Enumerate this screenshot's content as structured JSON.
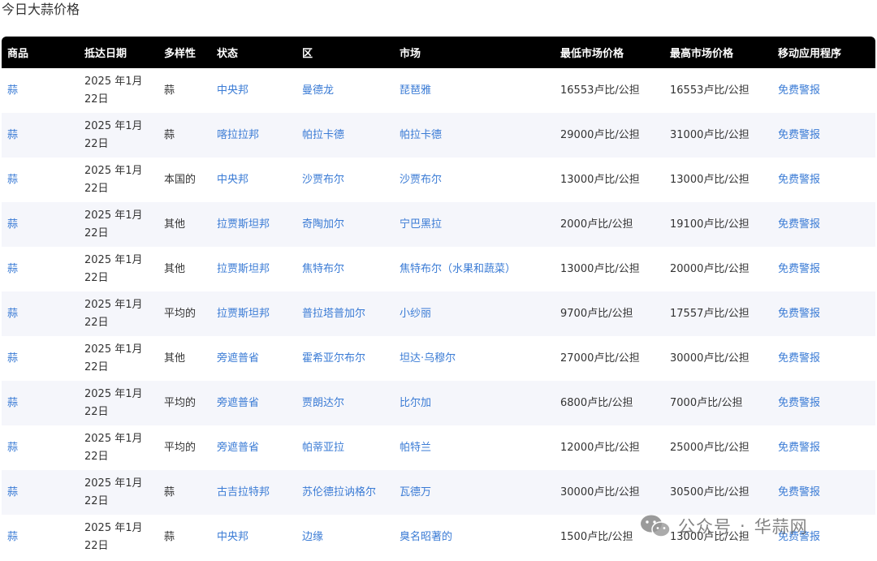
{
  "page": {
    "title": "今日大蒜价格"
  },
  "table": {
    "columns": [
      "商品",
      "抵达日期",
      "多样性",
      "状态",
      "区",
      "市场",
      "最低市场价格",
      "最高市场价格",
      "移动应用程序"
    ],
    "rows": [
      {
        "commodity": "蒜",
        "date": "2025 年1月22日",
        "variety": "蒜",
        "state": "中央邦",
        "district": "曼德龙",
        "market": "琵琶雅",
        "min_price": "16553卢比/公担",
        "max_price": "16553卢比/公担",
        "app": "免费警报"
      },
      {
        "commodity": "蒜",
        "date": "2025 年1月22日",
        "variety": "蒜",
        "state": "喀拉拉邦",
        "district": "帕拉卡德",
        "market": "帕拉卡德",
        "min_price": "29000卢比/公担",
        "max_price": "31000卢比/公担",
        "app": "免费警报"
      },
      {
        "commodity": "蒜",
        "date": "2025 年1月22日",
        "variety": "本国的",
        "state": "中央邦",
        "district": "沙贾布尔",
        "market": "沙贾布尔",
        "min_price": "13000卢比/公担",
        "max_price": "13000卢比/公担",
        "app": "免费警报"
      },
      {
        "commodity": "蒜",
        "date": "2025 年1月22日",
        "variety": "其他",
        "state": "拉贾斯坦邦",
        "district": "奇陶加尔",
        "market": "宁巴黑拉",
        "min_price": "2000卢比/公担",
        "max_price": "19100卢比/公担",
        "app": "免费警报"
      },
      {
        "commodity": "蒜",
        "date": "2025 年1月22日",
        "variety": "其他",
        "state": "拉贾斯坦邦",
        "district": "焦特布尔",
        "market": "焦特布尔（水果和蔬菜）",
        "min_price": "13000卢比/公担",
        "max_price": "20000卢比/公担",
        "app": "免费警报"
      },
      {
        "commodity": "蒜",
        "date": "2025 年1月22日",
        "variety": "平均的",
        "state": "拉贾斯坦邦",
        "district": "普拉塔普加尔",
        "market": "小纱丽",
        "min_price": "9700卢比/公担",
        "max_price": "17557卢比/公担",
        "app": "免费警报"
      },
      {
        "commodity": "蒜",
        "date": "2025 年1月22日",
        "variety": "其他",
        "state": "旁遮普省",
        "district": "霍希亚尔布尔",
        "market": "坦达·乌穆尔",
        "min_price": "27000卢比/公担",
        "max_price": "30000卢比/公担",
        "app": "免费警报"
      },
      {
        "commodity": "蒜",
        "date": "2025 年1月22日",
        "variety": "平均的",
        "state": "旁遮普省",
        "district": "贾朗达尔",
        "market": "比尔加",
        "min_price": "6800卢比/公担",
        "max_price": "7000卢比/公担",
        "app": "免费警报"
      },
      {
        "commodity": "蒜",
        "date": "2025 年1月22日",
        "variety": "平均的",
        "state": "旁遮普省",
        "district": "帕蒂亚拉",
        "market": "帕特兰",
        "min_price": "12000卢比/公担",
        "max_price": "25000卢比/公担",
        "app": "免费警报"
      },
      {
        "commodity": "蒜",
        "date": "2025 年1月22日",
        "variety": "蒜",
        "state": "古吉拉特邦",
        "district": "苏伦德拉讷格尔",
        "market": "瓦德万",
        "min_price": "30000卢比/公担",
        "max_price": "30500卢比/公担",
        "app": "免费警报"
      },
      {
        "commodity": "蒜",
        "date": "2025 年1月22日",
        "variety": "蒜",
        "state": "中央邦",
        "district": "边缘",
        "market": "臭名昭著的",
        "min_price": "1500卢比/公担",
        "max_price": "13000卢比/公担",
        "app": "免费警报"
      }
    ]
  },
  "watermark": {
    "icon": "wechat-icon",
    "text_left": "公众号",
    "separator": "·",
    "text_right": "华蒜网"
  },
  "colors": {
    "header_bg": "#000000",
    "link": "#3a7bd5",
    "row_alt": "#f5f6fb"
  }
}
